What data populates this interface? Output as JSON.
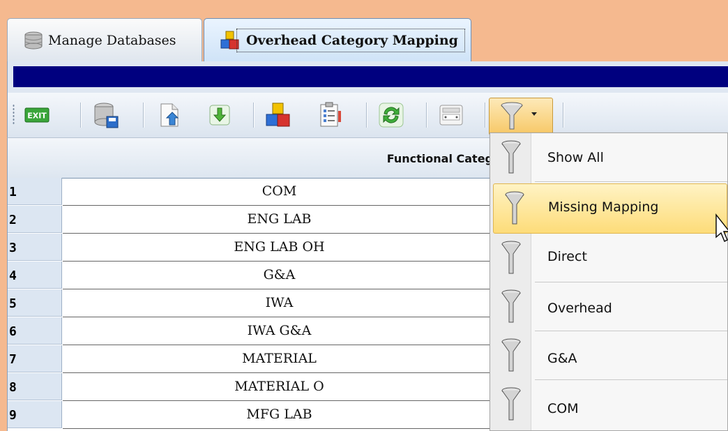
{
  "tabs": [
    {
      "label": "Manage Databases",
      "icon": "database-icon",
      "active": false
    },
    {
      "label": "Overhead Category Mapping",
      "icon": "blocks-icon",
      "active": true
    }
  ],
  "toolbar": {
    "exit_label": "EXIT",
    "buttons": [
      "exit-icon",
      "save-database-icon",
      "export-file-icon",
      "download-icon",
      "blocks-icon",
      "report-icon",
      "refresh-icon",
      "print-icon",
      "filter-icon"
    ]
  },
  "grid": {
    "column_header": "Functional Categ",
    "rows": [
      {
        "num": "1",
        "value": "COM"
      },
      {
        "num": "2",
        "value": "ENG LAB"
      },
      {
        "num": "3",
        "value": "ENG LAB OH"
      },
      {
        "num": "4",
        "value": "G&A"
      },
      {
        "num": "5",
        "value": "IWA"
      },
      {
        "num": "6",
        "value": "IWA G&A"
      },
      {
        "num": "7",
        "value": "MATERIAL"
      },
      {
        "num": "8",
        "value": "MATERIAL O"
      },
      {
        "num": "9",
        "value": "MFG LAB"
      }
    ]
  },
  "filter_menu": {
    "items": [
      {
        "label": "Show All",
        "highlighted": false
      },
      {
        "label": "Missing Mapping",
        "highlighted": true
      },
      {
        "label": "Direct",
        "highlighted": false
      },
      {
        "label": "Overhead",
        "highlighted": false
      },
      {
        "label": "G&A",
        "highlighted": false
      },
      {
        "label": "COM",
        "highlighted": false
      }
    ]
  },
  "colors": {
    "background": "#f5b98f",
    "navy_band": "#00007f",
    "highlight": "#fddc79"
  }
}
